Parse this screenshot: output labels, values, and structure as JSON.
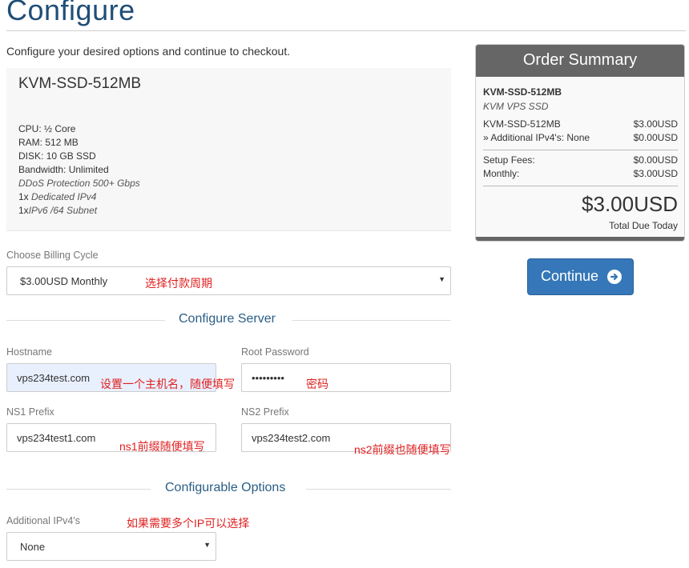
{
  "header": {
    "title": "Configure",
    "intro": "Configure your desired options and continue to checkout."
  },
  "product": {
    "name": "KVM-SSD-512MB",
    "specs": {
      "cpu_label": "CPU:",
      "cpu_value": "½ Core",
      "ram_label": "RAM:",
      "ram_value": "512 MB",
      "disk_label": "DISK:",
      "disk_value": "10 GB SSD",
      "bandwidth_label": "Bandwidth:",
      "bandwidth_value": "Unlimited",
      "ddos": "DDoS Protection 500+ Gbps",
      "ipv4_count": "1x",
      "ipv4_text": "Dedicated IPv4",
      "ipv6_count": "1x",
      "ipv6_text": "IPv6 /64 Subnet"
    }
  },
  "billing": {
    "label": "Choose Billing Cycle",
    "selected": "$3.00USD Monthly",
    "annotation": "选择付款周期"
  },
  "server_section": {
    "title": "Configure Server",
    "hostname_label": "Hostname",
    "hostname_value": "vps234test.com",
    "hostname_annotation": "设置一个主机名，随便填写",
    "root_password_label": "Root Password",
    "root_password_value": "•••••••••",
    "root_password_annotation": "密码",
    "ns1_label": "NS1 Prefix",
    "ns1_value": "vps234test1.com",
    "ns1_annotation": "ns1前缀随便填写",
    "ns2_label": "NS2 Prefix",
    "ns2_value": "vps234test2.com",
    "ns2_annotation": "ns2前缀也随便填写"
  },
  "options_section": {
    "title": "Configurable Options",
    "ipv4_label": "Additional IPv4's",
    "ipv4_selected": "None",
    "ipv4_annotation": "如果需要多个IP可以选择"
  },
  "summary": {
    "title": "Order Summary",
    "product_name": "KVM-SSD-512MB",
    "product_group": "KVM VPS SSD",
    "line_item": "KVM-SSD-512MB",
    "line_item_price": "$3.00USD",
    "addon": "» Additional IPv4's: None",
    "addon_price": "$0.00USD",
    "setup_label": "Setup Fees:",
    "setup_value": "$0.00USD",
    "monthly_label": "Monthly:",
    "monthly_value": "$3.00USD",
    "total": "$3.00USD",
    "total_label": "Total Due Today"
  },
  "actions": {
    "continue_label": "Continue"
  },
  "colors": {
    "title": "#1f4e79",
    "section_title": "#2a5e86",
    "annotation": "#e02020",
    "summary_header": "#666666",
    "continue_button": "#3577b8"
  }
}
